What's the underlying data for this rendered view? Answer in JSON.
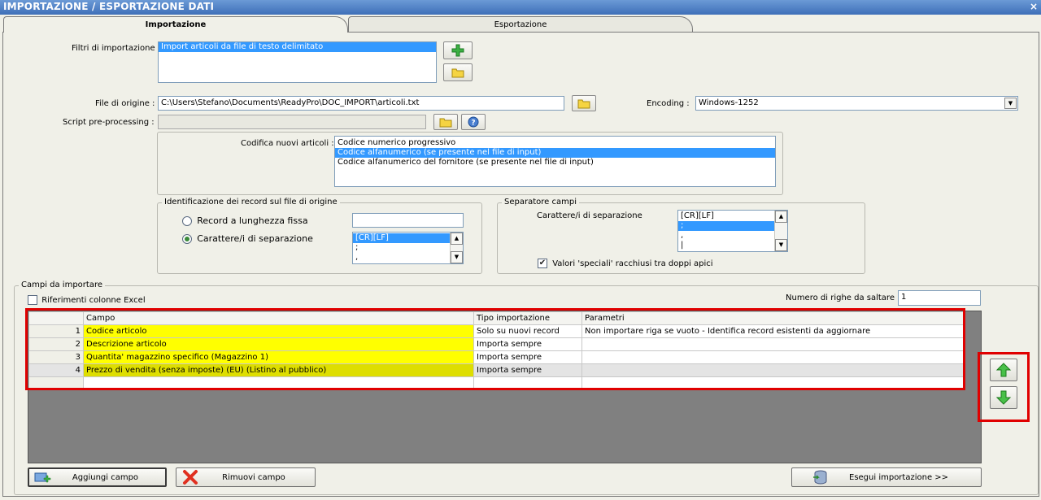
{
  "window": {
    "title": "IMPORTAZIONE / ESPORTAZIONE DATI",
    "close": "×"
  },
  "tabs": [
    {
      "label": "Importazione",
      "active": true
    },
    {
      "label": "Esportazione",
      "active": false
    }
  ],
  "filters": {
    "label": "Filtri di importazione :",
    "items": [
      "Import articoli da file di testo delimitato"
    ],
    "selected": 0
  },
  "source": {
    "label": "File di origine :",
    "value": "C:\\Users\\Stefano\\Documents\\ReadyPro\\DOC_IMPORT\\articoli.txt"
  },
  "encoding": {
    "label": "Encoding :",
    "value": "Windows-1252"
  },
  "script": {
    "label": "Script pre-processing :",
    "value": ""
  },
  "codifica": {
    "label": "Codifica nuovi articoli :",
    "items": [
      "Codice numerico progressivo",
      "Codice alfanumerico (se presente nel file di input)",
      "Codice alfanumerico del fornitore (se presente nel file di input)"
    ],
    "selected": 1
  },
  "identificazione": {
    "title": "Identificazione dei record sul file di origine",
    "option_fixed": "Record a lunghezza fissa",
    "option_sep": "Carattere/i di separazione",
    "selected_option": "sep",
    "list": [
      "[CR][LF]",
      ";",
      ","
    ]
  },
  "separatore": {
    "title": "Separatore campi",
    "label": "Carattere/i di separazione",
    "list": [
      "[CR][LF]",
      ";",
      ",",
      "|"
    ],
    "selected": 1,
    "checkbox_label": "Valori 'speciali' racchiusi tra doppi apici",
    "checkbox_checked": true,
    "checkmark": "✔"
  },
  "campi": {
    "title": "Campi da importare",
    "excel_label": "Riferimenti colonne Excel",
    "excel_checked": false,
    "skip_label": "Numero di righe da saltare :",
    "skip_value": "1",
    "columns": [
      "",
      "Campo",
      "Tipo importazione",
      "Parametri"
    ],
    "rows": [
      {
        "n": "1",
        "campo": "Codice articolo",
        "tipo": "Solo su nuovi record",
        "param": "Non importare riga se vuoto - Identifica record esistenti da aggiornare"
      },
      {
        "n": "2",
        "campo": "Descrizione articolo",
        "tipo": "Importa sempre",
        "param": ""
      },
      {
        "n": "3",
        "campo": "Quantita' magazzino specifico (Magazzino 1)",
        "tipo": "Importa sempre",
        "param": ""
      },
      {
        "n": "4",
        "campo": "Prezzo di vendita (senza imposte) (EU) (Listino al pubblico)",
        "tipo": "Importa sempre",
        "param": ""
      }
    ]
  },
  "buttons": {
    "add_field": "Aggiungi campo",
    "remove_field": "Rimuovi campo",
    "run_import": "Esegui importazione >>"
  },
  "colors": {
    "highlight": "#e00000",
    "selection": "#3399ff",
    "field_yellow": "#ffff00",
    "title_blue": "#3e6fb8"
  }
}
